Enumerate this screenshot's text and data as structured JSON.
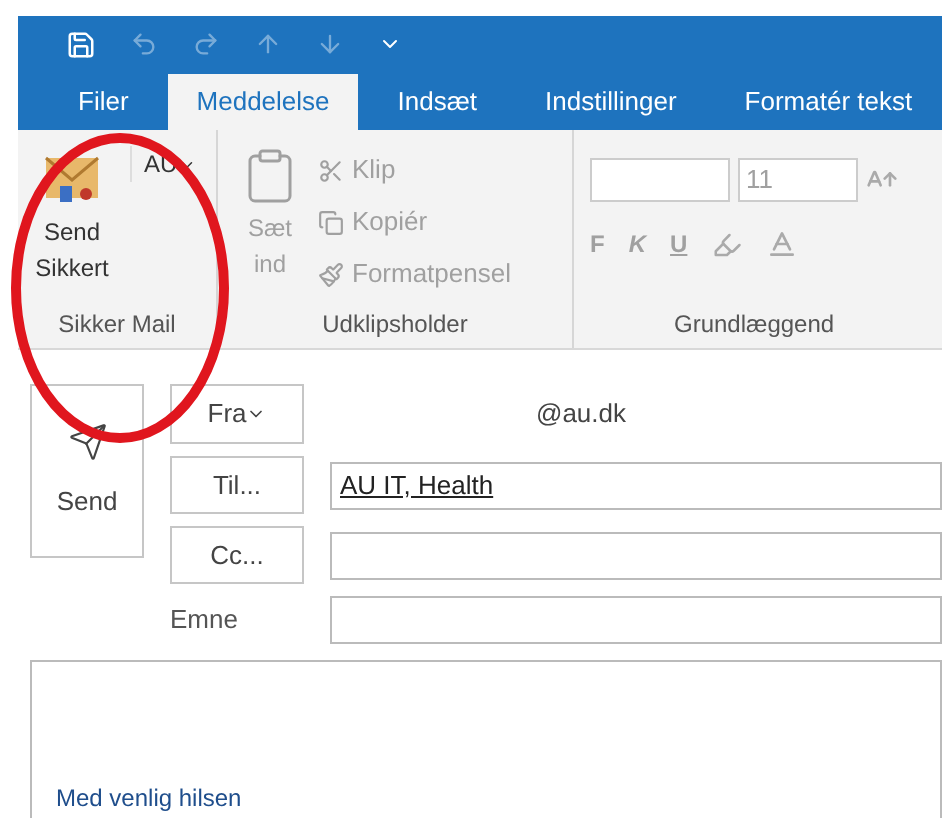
{
  "tabs": [
    {
      "label": "Filer",
      "selected": false
    },
    {
      "label": "Meddelelse",
      "selected": true
    },
    {
      "label": "Indsæt",
      "selected": false
    },
    {
      "label": "Indstillinger",
      "selected": false
    },
    {
      "label": "Formatér tekst",
      "selected": false
    }
  ],
  "ribbon": {
    "secure_mail": {
      "label": "Sikker Mail",
      "send_secure": "Send Sikkert",
      "account": "AU"
    },
    "clipboard": {
      "label": "Udklipsholder",
      "paste": "Sæt ind",
      "disabled": true,
      "items": [
        {
          "label": "Klip",
          "disabled": true
        },
        {
          "label": "Kopiér",
          "disabled": true
        },
        {
          "label": "Formatpensel",
          "disabled": true
        }
      ]
    },
    "font": {
      "label": "Grundlæggend",
      "size": "11",
      "disabled": true,
      "styles": [
        "F",
        "K",
        "U"
      ]
    }
  },
  "compose": {
    "send": "Send",
    "from": {
      "button": "Fra",
      "value": "@au.dk"
    },
    "to": {
      "button": "Til...",
      "recipients": "AU IT, Health"
    },
    "cc": {
      "button": "Cc..."
    },
    "subject": {
      "label": "Emne"
    },
    "body": {
      "signature": "Med venlig hilsen"
    }
  }
}
